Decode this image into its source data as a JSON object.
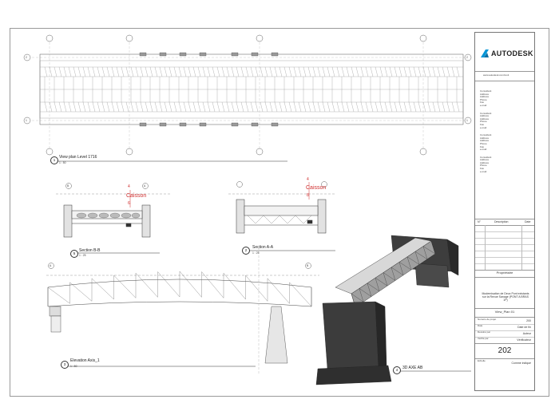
{
  "brand": {
    "name": "AUTODESK",
    "tagline": "www.autodesk.com/revit"
  },
  "title_block": {
    "consultants": [
      {
        "lines": [
          "Consultant",
          "Address",
          "Address",
          "Phone",
          "Fax",
          "e-mail"
        ]
      },
      {
        "lines": [
          "Consultant",
          "Address",
          "Address",
          "Phone",
          "Fax",
          "e-mail"
        ]
      },
      {
        "lines": [
          "Consultant",
          "Address",
          "Address",
          "Phone",
          "Fax",
          "e-mail"
        ]
      },
      {
        "lines": [
          "Consultant",
          "Address",
          "Address",
          "Phone",
          "Fax",
          "e-mail"
        ]
      }
    ],
    "rev_headers": {
      "no": "N°",
      "description": "Description",
      "date": "Date"
    },
    "owner": "Propriétaire",
    "project_name": "Modernisation de Deux Pont existants sur la Revue Sanage (PONT A BRAS 1P)",
    "sheet_name": "View_Plan 01",
    "fields": [
      {
        "label": "Numéro de projet",
        "value": "200"
      },
      {
        "label": "Date",
        "value": "Date de fin"
      },
      {
        "label": "Dessiné par",
        "value": "Auteur"
      },
      {
        "label": "Vérifié par",
        "value": "Vérificateur"
      }
    ],
    "sheet_number": "202",
    "scale_label": "Echelle",
    "scale_value": "Comme indiqué"
  },
  "views": [
    {
      "num": "1",
      "title": "View plan Level 1716",
      "scale": "1 : 50"
    },
    {
      "num": "5",
      "title": "Section B-B",
      "scale": "1 : 25"
    },
    {
      "num": "2",
      "title": "Section A-A",
      "scale": "1 : 25"
    },
    {
      "num": "3",
      "title": "Elevation Axis_1",
      "scale": "1 : 50"
    },
    {
      "num": "4",
      "title": "3D AXE AB",
      "scale": ""
    }
  ],
  "annotations": {
    "caisson_left": "Caisson",
    "caisson_right": "Caisson",
    "left_marks": [
      "4",
      "6"
    ],
    "right_marks": [
      "4",
      "8"
    ]
  },
  "grid_labels": {
    "a": "A",
    "b": "B",
    "one": "1",
    "two": "2"
  }
}
